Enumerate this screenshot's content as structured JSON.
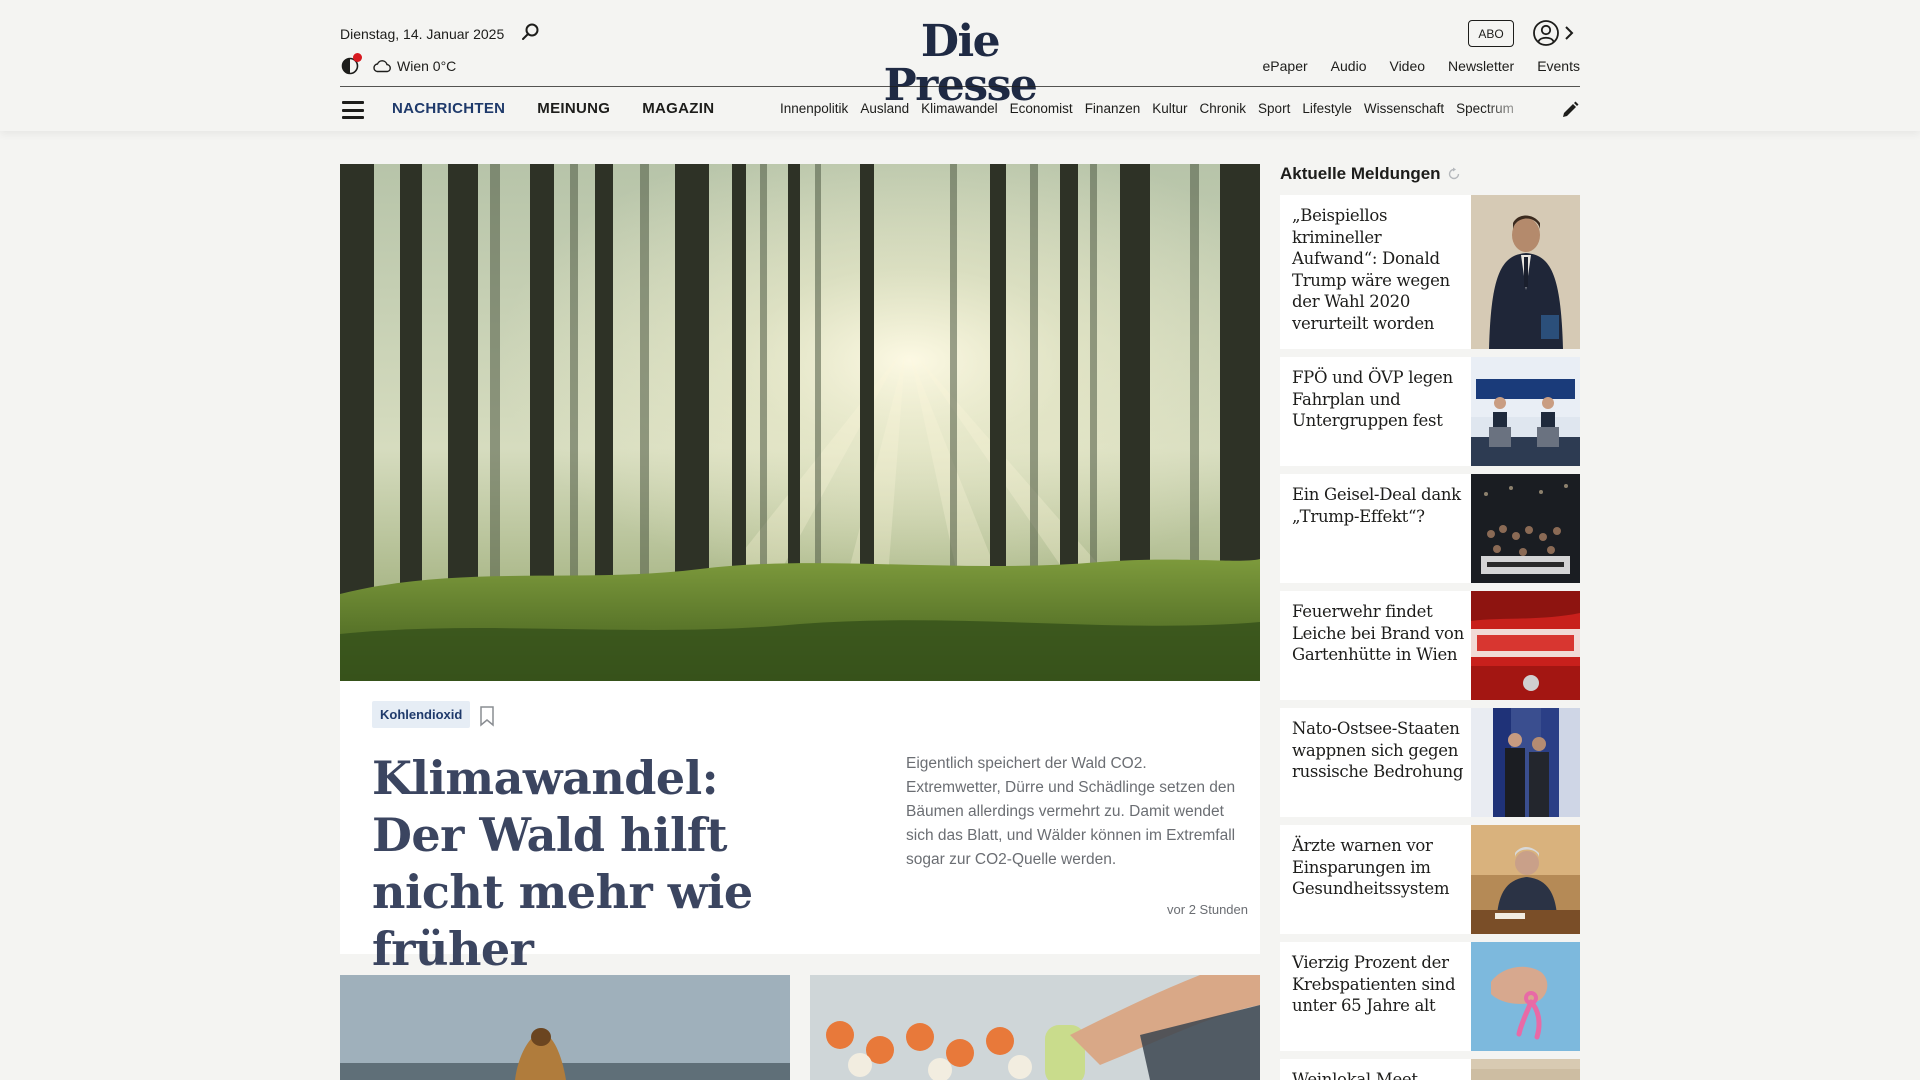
{
  "header": {
    "date": "Dienstag, 14. Januar 2025",
    "weather": "Wien 0°C",
    "logo": "Die Presse",
    "abo_label": "ABO",
    "util_nav": [
      "ePaper",
      "Audio",
      "Video",
      "Newsletter",
      "Events"
    ]
  },
  "nav": {
    "main": [
      "NACHRICHTEN",
      "MEINUNG",
      "MAGAZIN"
    ],
    "sections": [
      "Innenpolitik",
      "Ausland",
      "Klimawandel",
      "Economist",
      "Finanzen",
      "Kultur",
      "Chronik",
      "Sport",
      "Lifestyle",
      "Wissenschaft",
      "Spectrum"
    ]
  },
  "hero": {
    "tag": "Kohlendioxid",
    "title": "Klimawandel: Der Wald hilft nicht mehr wie früher",
    "teaser": "Eigentlich speichert der Wald CO2. Extremwetter, Dürre und Schädlinge setzen den Bäumen allerdings vermehrt zu. Damit wendet sich das Blatt, und Wälder können im Extremfall sogar zur CO2-Quelle werden.",
    "time": "vor 2 Stunden"
  },
  "sidebar": {
    "title": "Aktuelle Meldungen",
    "items": [
      {
        "headline": "„Beispiellos krimineller Aufwand“: Donald Trump wäre wegen der Wahl 2020 verurteilt worden"
      },
      {
        "headline": "FPÖ und ÖVP legen Fahrplan und Untergruppen fest"
      },
      {
        "headline": "Ein Geisel-Deal dank „Trump-Effekt“?"
      },
      {
        "headline": "Feuerwehr findet Leiche bei Brand von Gartenhütte in Wien"
      },
      {
        "headline": "Nato-Ostsee-Staaten wappnen sich gegen russische Bedrohung"
      },
      {
        "headline": "Ärzte warnen vor Einsparungen im Gesundheitssystem"
      },
      {
        "headline": "Vierzig Prozent der Krebspatienten sind unter 65 Jahre alt"
      },
      {
        "headline": "Weinlokal Meet"
      }
    ]
  },
  "colors": {
    "brand_navy": "#1f2a44",
    "accent_red": "#d71920",
    "nav_active": "#1f3a6b",
    "page_bg": "#f4f4f2"
  }
}
